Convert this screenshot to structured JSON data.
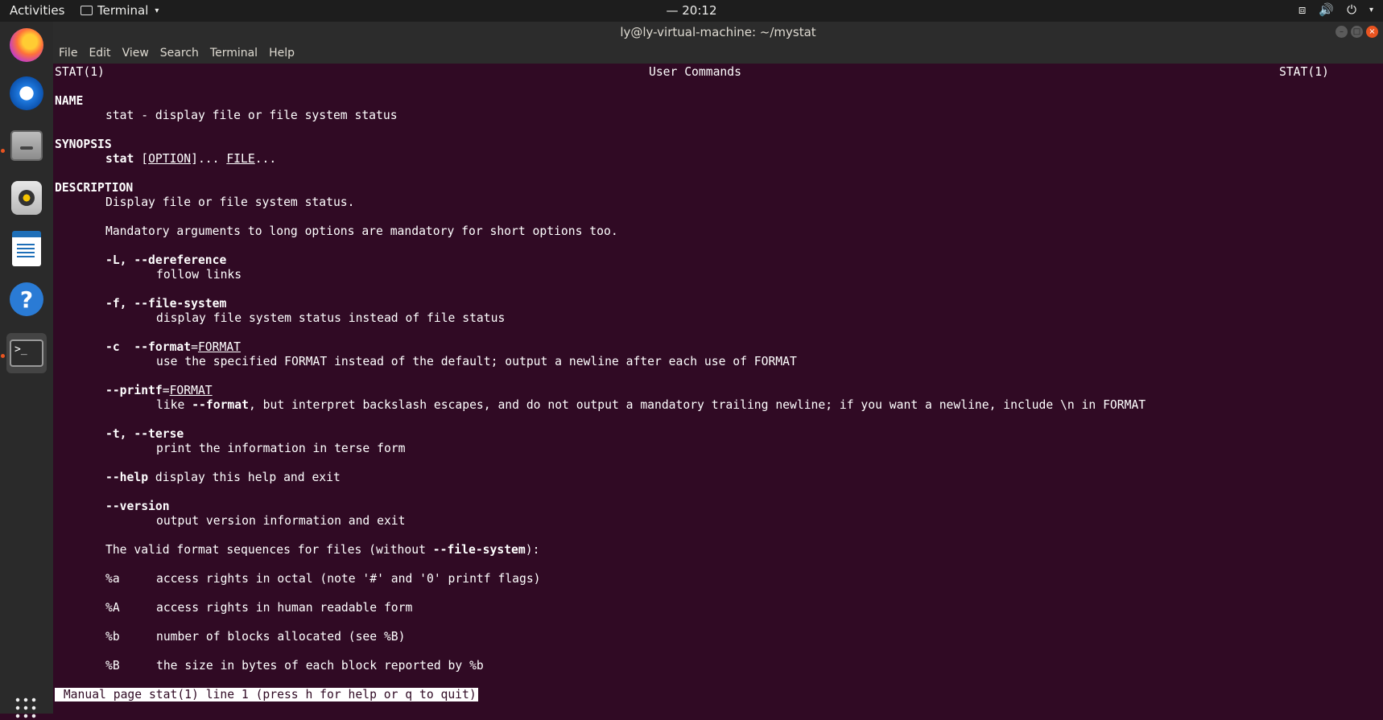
{
  "topbar": {
    "activities": "Activities",
    "app_name": "Terminal",
    "clock": "— 20:12",
    "tray_network": "⧈",
    "tray_volume": "🔊",
    "tray_power": "⏻",
    "tray_caret": "▾"
  },
  "dock": {
    "items": [
      "Firefox",
      "Thunderbird",
      "Files",
      "Rhythmbox",
      "LibreOffice Writer",
      "Help",
      "Terminal"
    ],
    "help_glyph": "?",
    "term_glyph": ">_"
  },
  "window": {
    "title": "ly@ly-virtual-machine: ~/mystat",
    "minimize": "–",
    "maximize": "□",
    "close": "×"
  },
  "menubar": {
    "file": "File",
    "edit": "Edit",
    "view": "View",
    "search": "Search",
    "terminal": "Terminal",
    "help": "Help"
  },
  "man": {
    "header_left": "STAT(1)",
    "header_center": "User Commands",
    "header_right": "STAT(1)",
    "name_heading": "NAME",
    "name_text": "stat - display file or file system status",
    "synopsis_heading": "SYNOPSIS",
    "synopsis_cmd": "stat",
    "synopsis_lbr": "[",
    "synopsis_option": "OPTION",
    "synopsis_rbr": "]... ",
    "synopsis_file": "FILE",
    "synopsis_dots": "...",
    "description_heading": "DESCRIPTION",
    "desc_line1": "Display file or file system status.",
    "desc_line2": "Mandatory arguments to long options are mandatory for short options too.",
    "opt_L": "-L, --dereference",
    "opt_L_desc": "follow links",
    "opt_f": "-f, --file-system",
    "opt_f_desc": "display file system status instead of file status",
    "opt_c_flag": "-c",
    "opt_c_long": "--format",
    "opt_c_eq": "=",
    "opt_c_arg": "FORMAT",
    "opt_c_desc": "use the specified FORMAT instead of the default; output a newline after each use of FORMAT",
    "opt_printf": "--printf",
    "opt_printf_eq": "=",
    "opt_printf_arg": "FORMAT",
    "opt_printf_desc_a": "like ",
    "opt_printf_desc_b": "--format",
    "opt_printf_desc_c": ", but interpret backslash escapes, and do not output a mandatory trailing newline; if you want a newline, include \\n in FORMAT",
    "opt_t": "-t, --terse",
    "opt_t_desc": "print the information in terse form",
    "opt_help": "--help",
    "opt_help_desc": " display this help and exit",
    "opt_version": "--version",
    "opt_version_desc": "output version information and exit",
    "valid_a": "The valid format sequences for files (without ",
    "valid_b": "--file-system",
    "valid_c": "):",
    "fmt_a_key": "%a",
    "fmt_a_desc": "access rights in octal (note '#' and '0' printf flags)",
    "fmt_A_key": "%A",
    "fmt_A_desc": "access rights in human readable form",
    "fmt_b_key": "%b",
    "fmt_b_desc": "number of blocks allocated (see %B)",
    "fmt_B_key": "%B",
    "fmt_B_desc": "the size in bytes of each block reported by %b",
    "status": " Manual page stat(1) line 1 (press h for help or q to quit)"
  }
}
